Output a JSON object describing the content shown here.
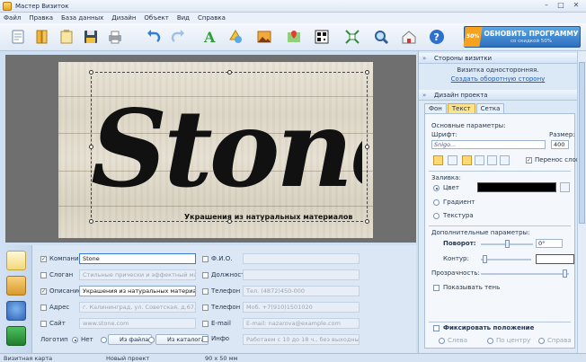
{
  "window": {
    "title": "Мастер Визиток",
    "controls": [
      "–",
      "□",
      "✕"
    ]
  },
  "menu": [
    "Файл",
    "Правка",
    "База данных",
    "Дизайн",
    "Объект",
    "Вид",
    "Справка"
  ],
  "toolbar": {
    "icons": [
      "new-card-icon",
      "open-book-icon",
      "templates-icon",
      "save-icon",
      "print-icon",
      "undo-icon",
      "redo-icon",
      "add-text-icon",
      "add-shape-icon",
      "add-image-icon",
      "add-map-icon",
      "add-qr-icon",
      "fit-icon",
      "zoom-icon",
      "order-print-icon",
      "help-icon"
    ],
    "promo_badge": "50%",
    "promo_title": "ОБНОВИТЬ ПРОГРАММУ",
    "promo_sub": "со скидкой 50%"
  },
  "card": {
    "logo_text": "Stone",
    "tagline": "Украшения из натуральных материалов"
  },
  "right_panel": {
    "sides_header": "Стороны визитки",
    "sides_info": "Визитка односторонняя.",
    "sides_link": "Создать оборотную сторону",
    "design_header": "Дизайн проекта",
    "tabs": [
      "Фон",
      "Текст",
      "Сетка"
    ],
    "active_tab": "Текст",
    "basic_params": "Основные параметры:",
    "font_label": "Шрифт:",
    "size_label": "Размер:",
    "font_value": "Snigo...",
    "size_value": "400",
    "wrap_label": "Перенос слов",
    "fill_label": "Заливка:",
    "fill_color": "Цвет",
    "fill_gradient": "Градиент",
    "fill_texture": "Текстура",
    "fill_color_value": "#000000",
    "extra_params": "Дополнительные параметры:",
    "rotation_label": "Поворот:",
    "rotation_value": "0°",
    "outline_label": "Контур:",
    "transparency_label": "Прозрачность:",
    "shadow_label": "Показывать тень",
    "fix_label": "Фиксировать положение",
    "align": [
      "Слева",
      "По центру",
      "Справа"
    ]
  },
  "fields": {
    "company": {
      "label": "Компания",
      "value": "Stone"
    },
    "slogan": {
      "label": "Слоган",
      "value": "Стильные прически и эффектный макияж"
    },
    "description": {
      "label": "Описание",
      "value": "Украшения из натуральных материалов"
    },
    "address": {
      "label": "Адрес",
      "value": "г. Калининград, ул. Советская, д.67, оф.XXX"
    },
    "site": {
      "label": "Сайт",
      "value": "www.stone.com"
    },
    "fio": {
      "label": "Ф.И.О.",
      "value": ""
    },
    "position": {
      "label": "Должность",
      "value": ""
    },
    "phone1": {
      "label": "Телефон 1",
      "value": "Тел. (4872)450-000"
    },
    "phone2": {
      "label": "Телефон 2",
      "value": "Моб. +7(910)1501020"
    },
    "email": {
      "label": "E-mail",
      "value": "E-mail: nazarova@example.com"
    },
    "info": {
      "label": "Инфо",
      "value": "Работаем с 10 до 18 ч., без выходных"
    },
    "logo_label": "Логотип",
    "logo_no": "Нет",
    "logo_from_file": "Из файла",
    "logo_from_catalog": "Из каталога"
  },
  "status": {
    "mode": "Визитная карта",
    "project": "Новый проект",
    "size": "90 x 50 мм"
  }
}
